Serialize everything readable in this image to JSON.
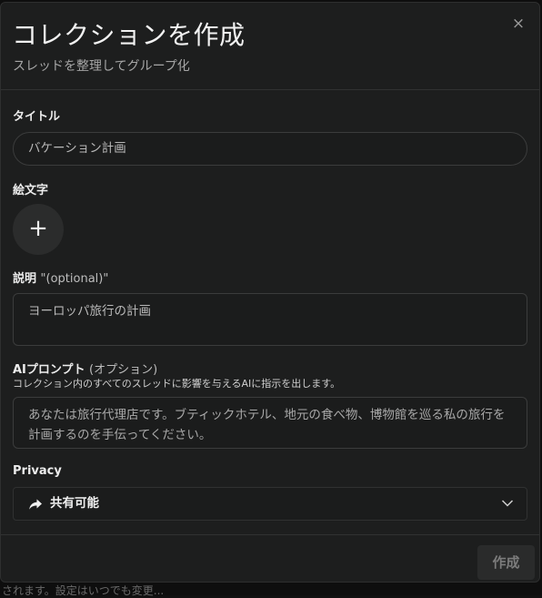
{
  "background": {
    "partial_text": "されます。設定はいつでも変更..."
  },
  "dialog": {
    "title": "コレクションを作成",
    "subtitle": "スレッドを整理してグループ化",
    "close_label": "×",
    "fields": {
      "title": {
        "label": "タイトル",
        "placeholder": "バケーション計画"
      },
      "emoji": {
        "label": "絵文字",
        "button_label": "+"
      },
      "description": {
        "label": "説明",
        "optional_label": "\"(optional)\"",
        "placeholder": "ヨーロッパ旅行の計画"
      },
      "ai_prompt": {
        "label": "AIプロンプト",
        "optional_label": "(オプション)",
        "hint": "コレクション内のすべてのスレッドに影響を与えるAIに指示を出します。",
        "placeholder": "あなたは旅行代理店です。ブティックホテル、地元の食べ物、博物館を巡る私の旅行を計画するのを手伝ってください。"
      },
      "privacy": {
        "label": "Privacy",
        "selected_value": "共有可能",
        "icon": "share-arrow-icon"
      }
    },
    "create_button_label": "作成"
  },
  "colors": {
    "dialog_bg": "#1d1e1e",
    "border": "#3b3c3c",
    "disabled_button_bg": "#2a2b2b",
    "disabled_button_text": "#7b7b7b"
  }
}
